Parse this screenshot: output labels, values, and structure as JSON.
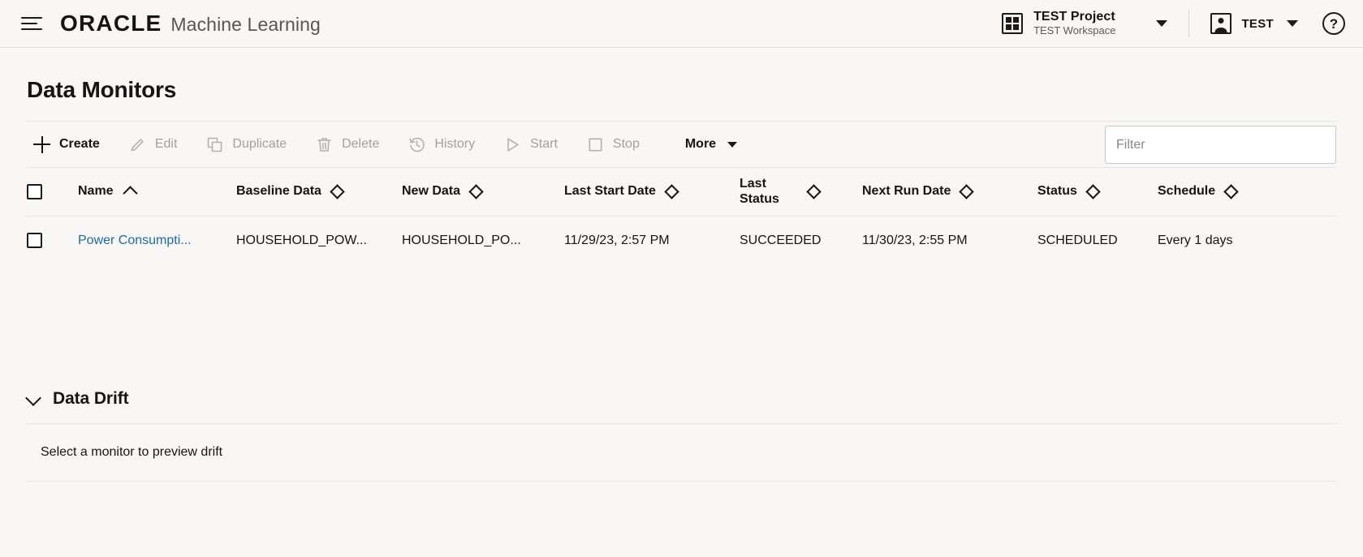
{
  "header": {
    "menu_icon": "hamburger-icon",
    "brand_primary": "ORACLE",
    "brand_secondary": "Machine Learning",
    "project": {
      "icon": "grid-icon",
      "name": "TEST Project",
      "workspace": "TEST Workspace",
      "caret_icon": "chevron-down-icon"
    },
    "user": {
      "icon": "user-avatar-icon",
      "name": "TEST",
      "caret_icon": "chevron-down-icon"
    },
    "help": {
      "icon": "help-question-icon",
      "glyph": "?"
    }
  },
  "page": {
    "title": "Data Monitors"
  },
  "toolbar": {
    "buttons": [
      {
        "label": "Create",
        "icon": "plus-icon",
        "enabled": true
      },
      {
        "label": "Edit",
        "icon": "pencil-icon",
        "enabled": false
      },
      {
        "label": "Duplicate",
        "icon": "copy-icon",
        "enabled": false
      },
      {
        "label": "Delete",
        "icon": "trash-icon",
        "enabled": false
      },
      {
        "label": "History",
        "icon": "history-icon",
        "enabled": false
      },
      {
        "label": "Start",
        "icon": "play-icon",
        "enabled": false
      },
      {
        "label": "Stop",
        "icon": "stop-icon",
        "enabled": false
      }
    ],
    "more_label": "More",
    "more_caret_icon": "caret-down-icon",
    "filter_placeholder": "Filter",
    "filter_value": ""
  },
  "table": {
    "select_all_icon": "checkbox-unchecked-icon",
    "columns": [
      {
        "label": "Name",
        "sort": "asc"
      },
      {
        "label": "Baseline Data",
        "sort": "none"
      },
      {
        "label": "New Data",
        "sort": "none"
      },
      {
        "label": "Last Start Date",
        "sort": "none"
      },
      {
        "label": "Last Status",
        "sort": "none"
      },
      {
        "label": "Next Run Date",
        "sort": "none"
      },
      {
        "label": "Status",
        "sort": "none"
      },
      {
        "label": "Schedule",
        "sort": "none"
      }
    ],
    "rows": [
      {
        "checkbox_icon": "checkbox-unchecked-icon",
        "name": "Power Consumpti...",
        "baseline_data": "HOUSEHOLD_POW...",
        "new_data": "HOUSEHOLD_PO...",
        "last_start_date": "11/29/23, 2:57 PM",
        "last_status": "SUCCEEDED",
        "next_run_date": "11/30/23, 2:55 PM",
        "status": "SCHEDULED",
        "schedule": "Every 1 days"
      }
    ]
  },
  "data_drift": {
    "chevron_icon": "chevron-down-icon",
    "title": "Data Drift",
    "empty_message": "Select a monitor to preview drift"
  },
  "colors": {
    "page_background": "#f8f7f5",
    "text_primary": "#161513",
    "text_disabled": "#a3a09c",
    "link": "#1a6ca8",
    "border": "#e8e5e1",
    "input_border": "#c9c6c1"
  }
}
